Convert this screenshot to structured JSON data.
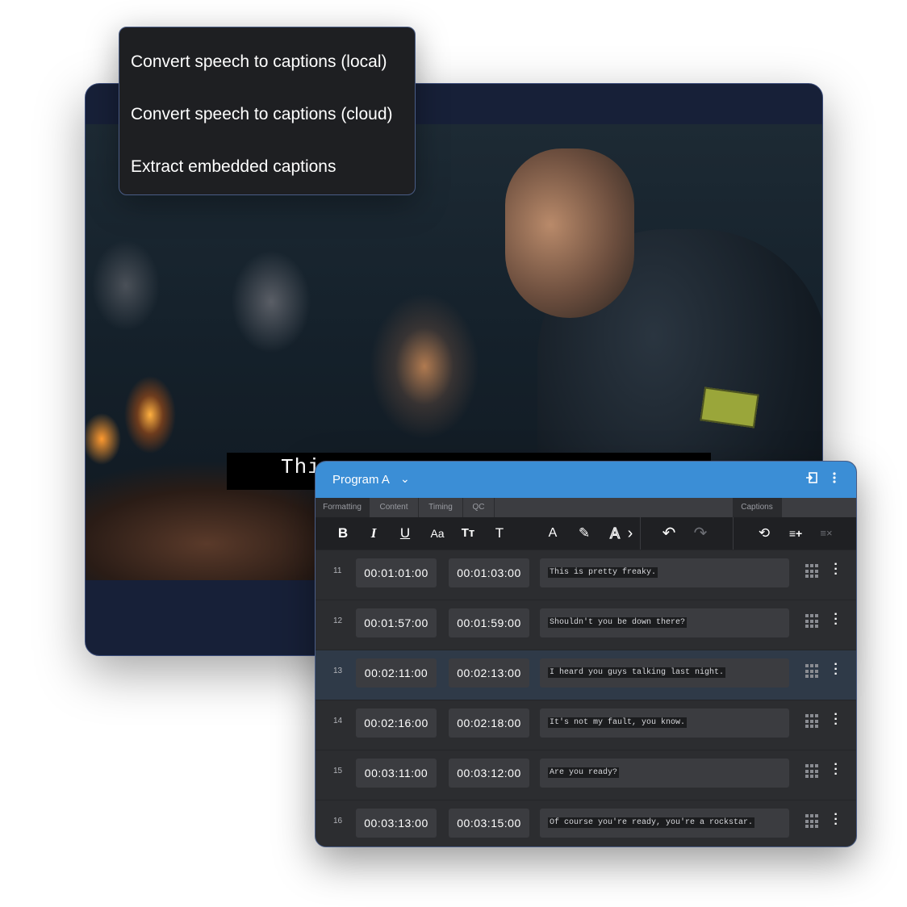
{
  "menu": {
    "items": [
      {
        "label": "Convert speech to captions (local)"
      },
      {
        "label": "Convert speech to captions (cloud)"
      },
      {
        "label": "Extract embedded captions"
      }
    ]
  },
  "video": {
    "subtitle": "Thi"
  },
  "editor": {
    "title": "Program A",
    "title_chevron": "⌄",
    "tabs": {
      "formatting": "Formatting",
      "content": "Content",
      "timing": "Timing",
      "qc": "QC",
      "captions": "Captions"
    },
    "toolbar": {
      "bold": "B",
      "italic": "I",
      "underline": "U",
      "case": "Aa",
      "small_caps": "Tт",
      "text": "T",
      "font_color": "A",
      "highlight": "✎",
      "outline": "A",
      "more": "›",
      "undo": "↶",
      "redo": "↷",
      "find_replace": "⟲",
      "add_row": "≡+",
      "clear": "≡×"
    },
    "rows": [
      {
        "num": "11",
        "start": "00:01:01:00",
        "end": "00:01:03:00",
        "text": "This is pretty freaky."
      },
      {
        "num": "12",
        "start": "00:01:57:00",
        "end": "00:01:59:00",
        "text": "Shouldn't you be down there?"
      },
      {
        "num": "13",
        "start": "00:02:11:00",
        "end": "00:02:13:00",
        "text": "I heard you guys talking last night."
      },
      {
        "num": "14",
        "start": "00:02:16:00",
        "end": "00:02:18:00",
        "text": "It's not my fault, you know."
      },
      {
        "num": "15",
        "start": "00:03:11:00",
        "end": "00:03:12:00",
        "text": "Are you ready?"
      },
      {
        "num": "16",
        "start": "00:03:13:00",
        "end": "00:03:15:00",
        "text": "Of course you're ready, you're a rockstar."
      }
    ],
    "selected_row": "13",
    "accent_color": "#3b8ed6"
  }
}
